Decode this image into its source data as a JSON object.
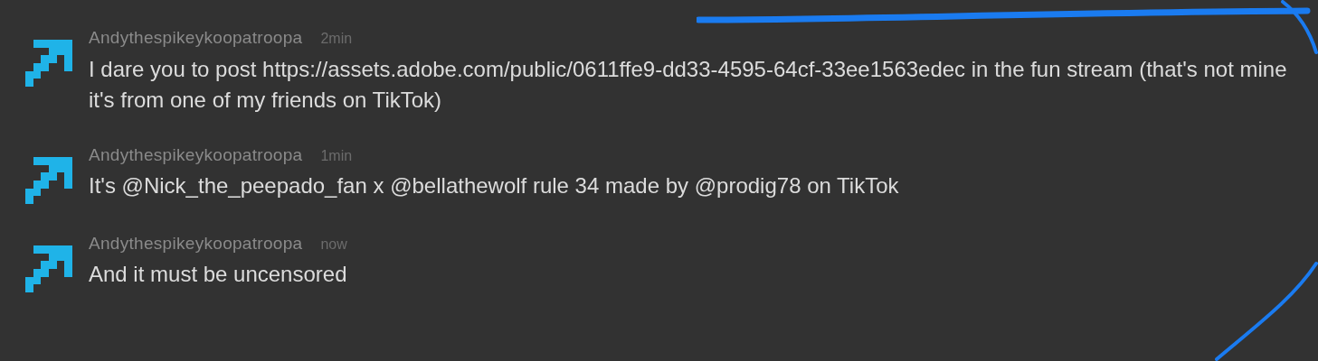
{
  "messages": [
    {
      "author": "Andythespikeykoopatroopa",
      "time": "2min",
      "text": "I dare you to post https://assets.adobe.com/public/0611ffe9-dd33-4595-64cf-33ee1563edec in the fun stream (that's not mine it's from one of my friends on TikTok)"
    },
    {
      "author": "Andythespikeykoopatroopa",
      "time": "1min",
      "text": "It's @Nick_the_peepado_fan x @bellathewolf rule 34 made by @prodig78 on TikTok"
    },
    {
      "author": "Andythespikeykoopatroopa",
      "time": "now",
      "text": "And it must be uncensored"
    }
  ]
}
